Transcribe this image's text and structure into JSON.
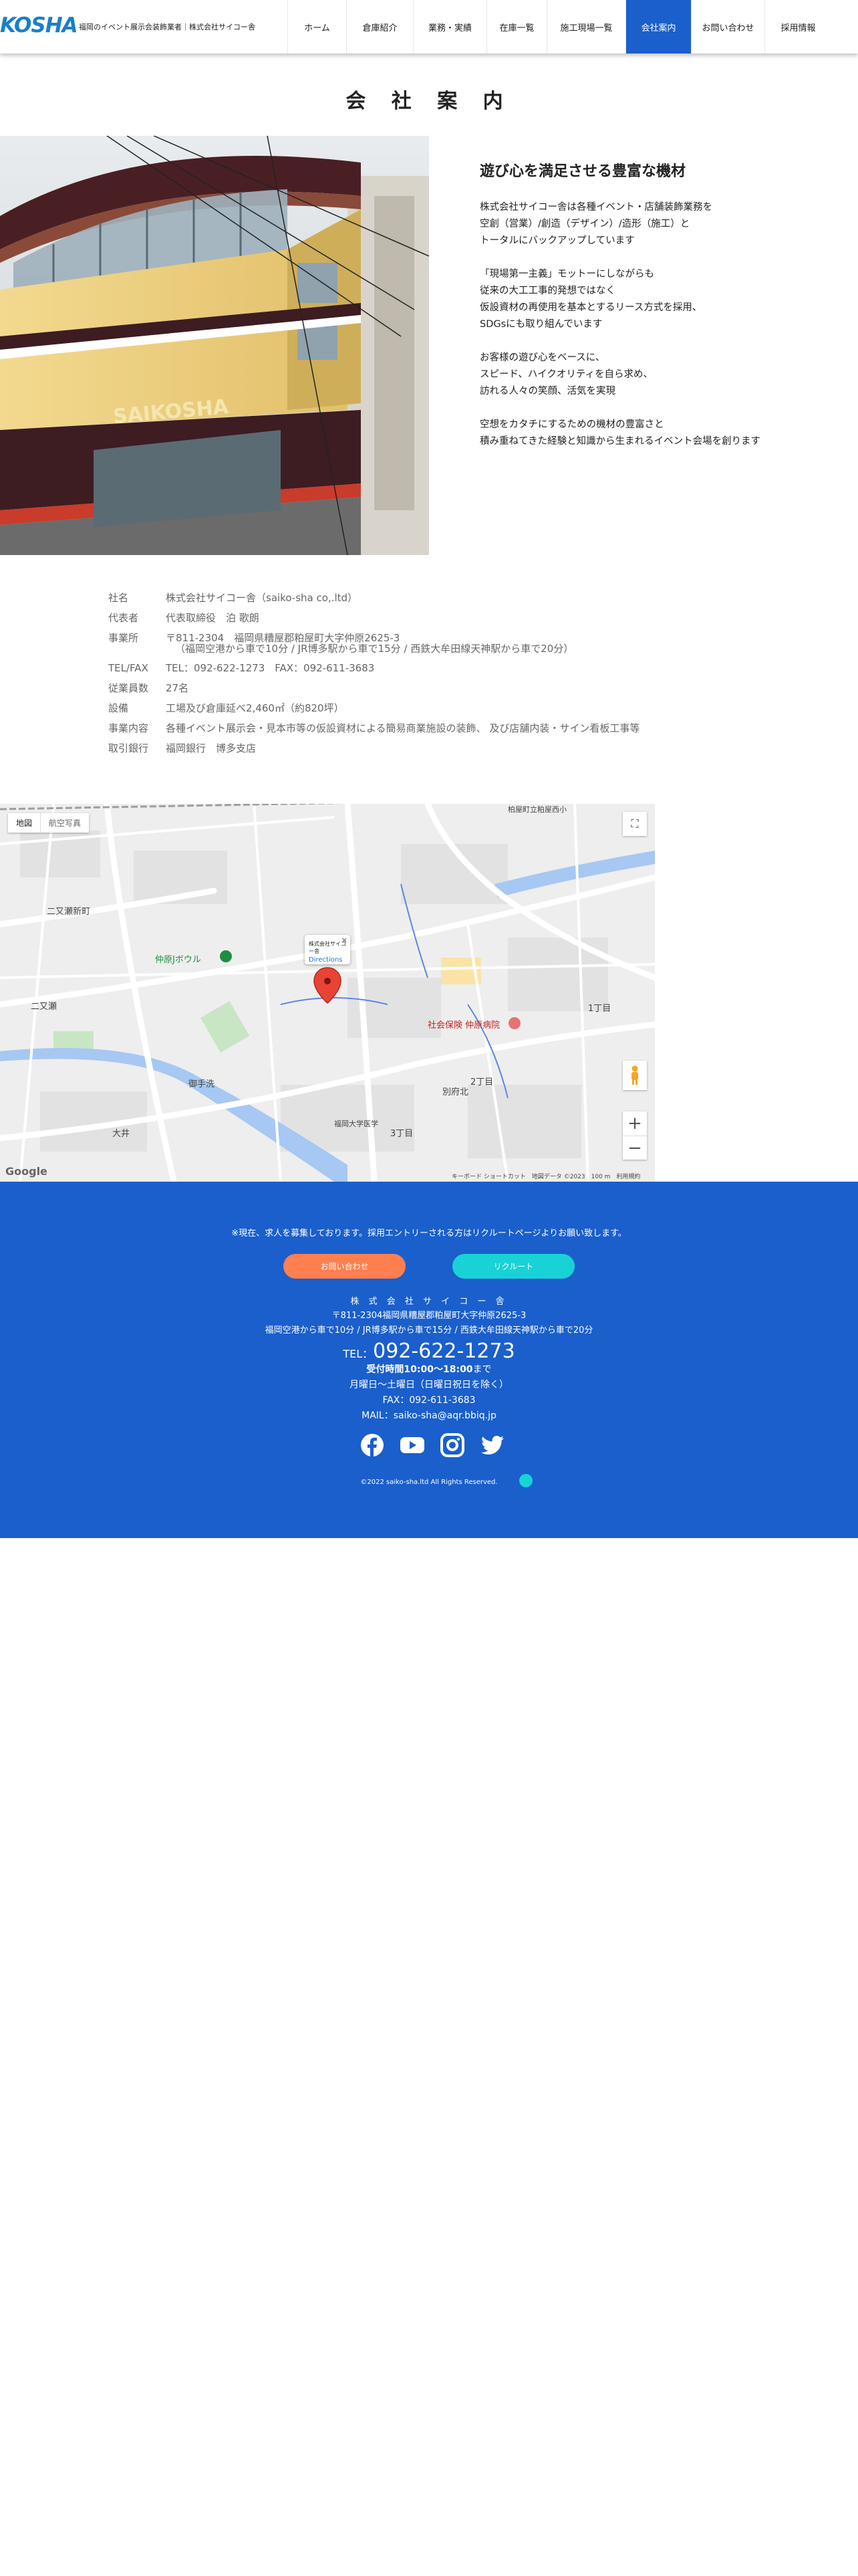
{
  "header": {
    "logo_text": "KOSHA",
    "tagline": "福岡のイベント展示会装飾業者｜株式会社サイコー舎",
    "nav": [
      {
        "label": "ホーム",
        "active": false
      },
      {
        "label": "倉庫紹介",
        "active": false
      },
      {
        "label": "業務・実績",
        "active": false
      },
      {
        "label": "在庫一覧",
        "active": false
      },
      {
        "label": "施工現場一覧",
        "active": false
      },
      {
        "label": "会社案内",
        "active": true
      },
      {
        "label": "お問い合わせ",
        "active": false
      },
      {
        "label": "採用情報",
        "active": false
      }
    ]
  },
  "page": {
    "title": "会 社 案 内"
  },
  "building": {
    "sign_text": "SAIKOSHA"
  },
  "intro": {
    "heading": "遊び心を満足させる豊富な機材",
    "paragraphs": [
      [
        "株式会社サイコー舎は各種イベント・店舗装飾業務を",
        "空創（営業）/創造（デザイン）/造形（施工）と",
        "トータルにバックアップしています"
      ],
      [
        "「現場第一主義」モットーにしながらも",
        "従来の大工工事的発想ではなく",
        "仮設資材の再使用を基本とするリース方式を採用、",
        "SDGsにも取り組んでいます"
      ],
      [
        "お客様の遊び心をベースに、",
        "スピード、ハイクオリティを自ら求め、",
        "訪れる人々の笑顔、活気を実現"
      ],
      [
        "空想をカタチにするための機材の豊富さと",
        "積み重ねてきた経験と知識から生まれるイベント会場を創ります"
      ]
    ]
  },
  "company_info": {
    "rows": [
      {
        "label": "社名",
        "value": "株式会社サイコー舎（saiko-sha co,.ltd）"
      },
      {
        "label": "代表者",
        "value": "代表取締役　泊 歌朗"
      },
      {
        "label": "事業所",
        "value": "〒811-2304　福岡県糟屋郡粕屋町大字仲原2625-3",
        "sub": "（福岡空港から車で10分 / JR博多駅から車で15分 / 西鉄大牟田線天神駅から車で20分）"
      },
      {
        "label": "TEL/FAX",
        "value": "TEL：092-622-1273　FAX：092-611-3683"
      },
      {
        "label": "従業員数",
        "value": "27名"
      },
      {
        "label": "設備",
        "value": "工場及び倉庫延べ2,460㎡（約820坪）"
      },
      {
        "label": "事業内容",
        "value": "各種イベント展示会・見本市等の仮設資材による簡易商業施設の装飾、 及び店舗内装・サイン看板工事等"
      },
      {
        "label": "取引銀行",
        "value": "福岡銀行　博多支店"
      }
    ]
  },
  "map": {
    "btn_map": "地図",
    "btn_satellite": "航空写真",
    "infowindow_title": "株式会社サイコー舎",
    "infowindow_link": "Directions",
    "labels": {
      "nijiseshin": "二又瀬新町",
      "nijise": "二又瀬",
      "bowl": "仲原Jボウル",
      "hospital": "社会保険 仲原病院",
      "mitesu": "御手洗",
      "oi": "大井",
      "kashiwara_kita": "別府北",
      "chome1": "1丁目",
      "chome2": "2丁目",
      "chome3": "3丁目",
      "shinya": "福岡大学医学",
      "kihaku": "柏屋町立粕屋西小"
    },
    "google": "Google",
    "footer": "キーボード ショートカット　地図データ ©2023　100 m　利用規約"
  },
  "footer": {
    "recruit_note": "※現在、求人を募集しております。採用エントリーされる方はリクルートページよりお願い致します。",
    "contact_button": "お問い合わせ",
    "recruit_button": "リクルート",
    "company": "株 式 会 社 サ イ コ ー 舎",
    "address": "〒811-2304福岡県糟屋郡粕屋町大字仲原2625-3",
    "access": "福岡空港から車で10分 / JR博多駅から車で15分 / 西鉄大牟田線天神駅から車で20分",
    "tel_prefix": "TEL：",
    "tel": "092-622-1273",
    "hours_bold": "受付時間10:00〜18:00",
    "hours_suffix": "まで",
    "days": "月曜日〜土曜日（日曜日祝日を除く）",
    "fax": "FAX：092-611-3683",
    "mail": "MAIL：saiko-sha@aqr.bbiq.jp",
    "social": [
      "facebook-icon",
      "youtube-icon",
      "instagram-icon",
      "twitter-icon"
    ],
    "copyright": "©2022 saiko-sha.ltd All Rights Reserved."
  }
}
